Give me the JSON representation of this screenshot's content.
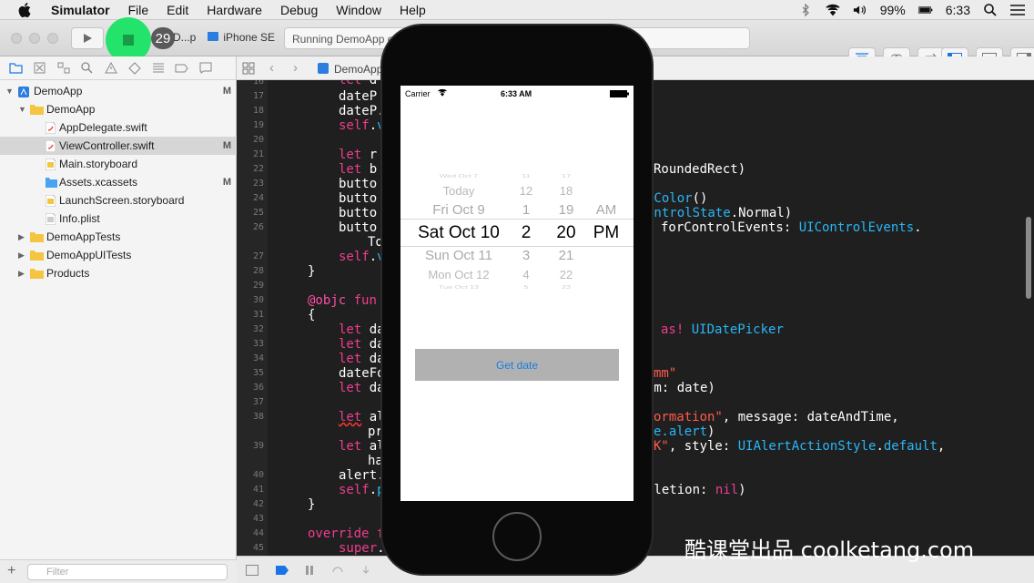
{
  "menubar": {
    "items": [
      "Simulator",
      "File",
      "Edit",
      "Hardware",
      "Debug",
      "Window",
      "Help"
    ],
    "battery": "99%",
    "time": "6:33"
  },
  "toolbar": {
    "badge": "29",
    "scheme_target": "D...p",
    "device": "iPhone SE",
    "status": "Running DemoApp o"
  },
  "jumpbar": {
    "file": "DemoApp"
  },
  "navigator": {
    "items": [
      {
        "label": "DemoApp",
        "mark": "M"
      },
      {
        "label": "DemoApp",
        "mark": ""
      },
      {
        "label": "AppDelegate.swift",
        "mark": ""
      },
      {
        "label": "ViewController.swift",
        "mark": "M"
      },
      {
        "label": "Main.storyboard",
        "mark": ""
      },
      {
        "label": "Assets.xcassets",
        "mark": "M"
      },
      {
        "label": "LaunchScreen.storyboard",
        "mark": ""
      },
      {
        "label": "Info.plist",
        "mark": ""
      },
      {
        "label": "DemoAppTests",
        "mark": ""
      },
      {
        "label": "DemoAppUITests",
        "mark": ""
      },
      {
        "label": "Products",
        "mark": ""
      }
    ],
    "filter_placeholder": "Filter"
  },
  "editor": {
    "line_numbers": [
      "16",
      "17",
      "18",
      "19",
      "20",
      "21",
      "22",
      "23",
      "24",
      "25",
      "26",
      "",
      "27",
      "28",
      "29",
      "30",
      "31",
      "32",
      "33",
      "34",
      "35",
      "36",
      "37",
      "38",
      "",
      "39",
      "",
      "40",
      "41",
      "42",
      "43",
      "44",
      "45"
    ]
  },
  "simulator": {
    "carrier": "Carrier",
    "time": "6:33 AM",
    "picker": {
      "dates": [
        "Wed Oct 7",
        "Today",
        "Fri Oct 9",
        "Sat Oct 10",
        "Sun Oct 11",
        "Mon Oct 12",
        "Tue Oct 13"
      ],
      "hours": [
        "11",
        "12",
        "1",
        "2",
        "3",
        "4",
        "5"
      ],
      "minutes": [
        "17",
        "18",
        "19",
        "20",
        "21",
        "22",
        "23"
      ],
      "ampm": [
        "AM",
        "PM"
      ]
    },
    "button_label": "Get date"
  },
  "watermark": "酷课堂出品 coolketang.com"
}
